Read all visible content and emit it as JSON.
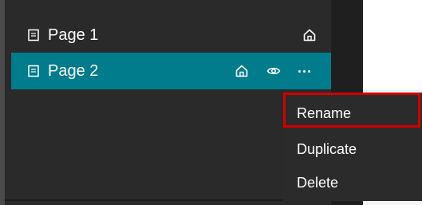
{
  "pages": [
    {
      "label": "Page 1",
      "selected": false,
      "actions": [
        "home-icon"
      ]
    },
    {
      "label": "Page 2",
      "selected": true,
      "actions": [
        "home-icon",
        "eye-icon",
        "more-icon"
      ]
    }
  ],
  "context_menu": {
    "items": [
      {
        "label": "Rename",
        "highlighted": true
      },
      {
        "label": "Duplicate",
        "highlighted": false
      },
      {
        "label": "Delete",
        "highlighted": false
      }
    ]
  },
  "colors": {
    "panel_bg": "#2a2a2a",
    "selected_row_bg": "#007c8c",
    "menu_bg": "#2b2b2b",
    "highlight_border": "#d30000",
    "text": "#ffffff"
  }
}
